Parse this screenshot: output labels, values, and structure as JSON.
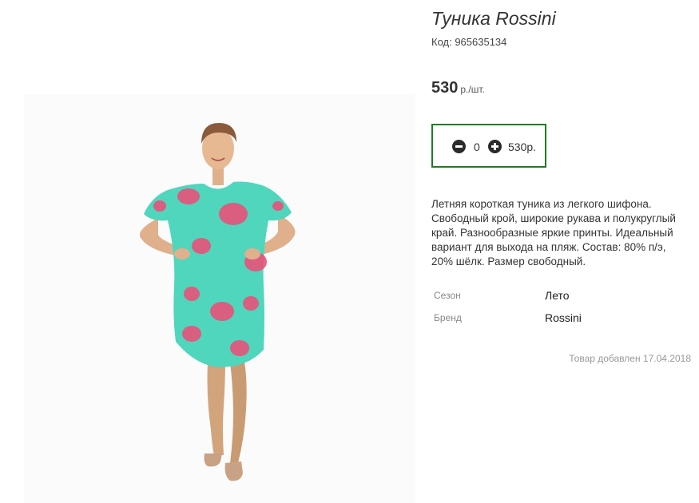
{
  "product": {
    "title": "Туника Rossini",
    "sku": "Код: 965635134",
    "price": "530",
    "price_unit": "р./шт.",
    "image_description": "product-photo"
  },
  "cart": {
    "quantity": "0",
    "total": "530р.",
    "minus_icon": "minus-circle-icon",
    "plus_icon": "plus-circle-icon",
    "border_color": "#1f7d1f"
  },
  "description": [
    "Летняя короткая туника из легкого шифона.",
    "Свободный крой, широкие рукава и полукруглый",
    "край. Разнообразные яркие принты. Идеальный",
    "вариант для выхода на пляж. Состав: 80% п/э,",
    "20% шёлк. Размер свободный."
  ],
  "properties": [
    {
      "name": "Сезон",
      "value": "Лето"
    },
    {
      "name": "Бренд",
      "value": "Rossini"
    }
  ],
  "added": "Товар добавлен 17.04.2018",
  "colors": {
    "tunic": "#4fd6bd",
    "flower": "#e8527a"
  }
}
